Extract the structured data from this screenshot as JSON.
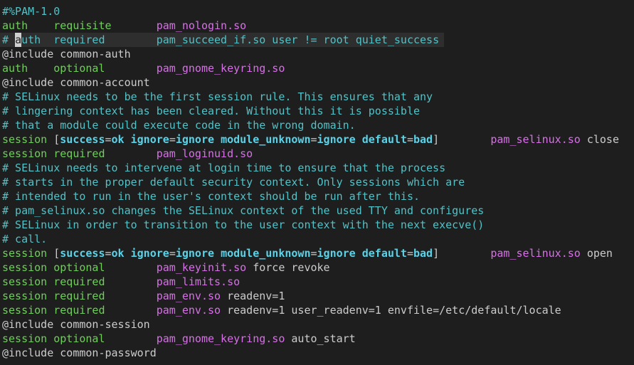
{
  "editor": {
    "colors": {
      "background": "#1e1e1e",
      "current_line": "#2e2e2e",
      "keyword_green": "#6fcf5a",
      "comment_cyan": "#4fc3c8",
      "module_magenta": "#d870e8",
      "bracket_key_cyan": "#5ad3e8",
      "plain": "#cccccc"
    },
    "cursor": {
      "line": 2,
      "col": 2,
      "char": "a"
    },
    "current_line_index": 2,
    "lines": [
      [
        {
          "t": "#%PAM-1.0",
          "c": "comment"
        }
      ],
      [
        {
          "t": "auth    requisite       ",
          "c": "kw"
        },
        {
          "t": "pam_nologin.so",
          "c": "mod"
        }
      ],
      [
        {
          "t": "# auth  required        pam_succeed_if.so user != root quiet_success",
          "c": "comment"
        }
      ],
      [
        {
          "t": "@include common-auth",
          "c": "plain"
        }
      ],
      [
        {
          "t": "auth    optional        ",
          "c": "kw"
        },
        {
          "t": "pam_gnome_keyring.so",
          "c": "mod"
        }
      ],
      [
        {
          "t": "@include common-account",
          "c": "plain"
        }
      ],
      [
        {
          "t": "# SELinux needs to be the first session rule. This ensures that any",
          "c": "comment"
        }
      ],
      [
        {
          "t": "# lingering context has been cleared. Without this it is possible",
          "c": "comment"
        }
      ],
      [
        {
          "t": "# that a module could execute code in the wrong domain.",
          "c": "comment"
        }
      ],
      [
        {
          "t": "session ",
          "c": "kw"
        },
        {
          "t": "[",
          "c": "plain"
        },
        {
          "t": "success",
          "c": "bkey"
        },
        {
          "t": "=",
          "c": "plain"
        },
        {
          "t": "ok",
          "c": "bkey"
        },
        {
          "t": " ",
          "c": "plain"
        },
        {
          "t": "ignore",
          "c": "bkey"
        },
        {
          "t": "=",
          "c": "plain"
        },
        {
          "t": "ignore",
          "c": "bkey"
        },
        {
          "t": " ",
          "c": "plain"
        },
        {
          "t": "module_unknown",
          "c": "bkey"
        },
        {
          "t": "=",
          "c": "plain"
        },
        {
          "t": "ignore",
          "c": "bkey"
        },
        {
          "t": " ",
          "c": "plain"
        },
        {
          "t": "default",
          "c": "bkey"
        },
        {
          "t": "=",
          "c": "plain"
        },
        {
          "t": "bad",
          "c": "bkey"
        },
        {
          "t": "]        ",
          "c": "plain"
        },
        {
          "t": "pam_selinux.so",
          "c": "mod"
        },
        {
          "t": " close",
          "c": "plain"
        }
      ],
      [
        {
          "t": "session required        ",
          "c": "kw"
        },
        {
          "t": "pam_loginuid.so",
          "c": "mod"
        }
      ],
      [
        {
          "t": "# SELinux needs to intervene at login time to ensure that the process",
          "c": "comment"
        }
      ],
      [
        {
          "t": "# starts in the proper default security context. Only sessions which are",
          "c": "comment"
        }
      ],
      [
        {
          "t": "# intended to run in the user's context should be run after this.",
          "c": "comment"
        }
      ],
      [
        {
          "t": "# pam_selinux.so changes the SELinux context of the used TTY and configures",
          "c": "comment"
        }
      ],
      [
        {
          "t": "# SELinux in order to transition to the user context with the next execve()",
          "c": "comment"
        }
      ],
      [
        {
          "t": "# call.",
          "c": "comment"
        }
      ],
      [
        {
          "t": "session ",
          "c": "kw"
        },
        {
          "t": "[",
          "c": "plain"
        },
        {
          "t": "success",
          "c": "bkey"
        },
        {
          "t": "=",
          "c": "plain"
        },
        {
          "t": "ok",
          "c": "bkey"
        },
        {
          "t": " ",
          "c": "plain"
        },
        {
          "t": "ignore",
          "c": "bkey"
        },
        {
          "t": "=",
          "c": "plain"
        },
        {
          "t": "ignore",
          "c": "bkey"
        },
        {
          "t": " ",
          "c": "plain"
        },
        {
          "t": "module_unknown",
          "c": "bkey"
        },
        {
          "t": "=",
          "c": "plain"
        },
        {
          "t": "ignore",
          "c": "bkey"
        },
        {
          "t": " ",
          "c": "plain"
        },
        {
          "t": "default",
          "c": "bkey"
        },
        {
          "t": "=",
          "c": "plain"
        },
        {
          "t": "bad",
          "c": "bkey"
        },
        {
          "t": "]        ",
          "c": "plain"
        },
        {
          "t": "pam_selinux.so",
          "c": "mod"
        },
        {
          "t": " open",
          "c": "plain"
        }
      ],
      [
        {
          "t": "session optional        ",
          "c": "kw"
        },
        {
          "t": "pam_keyinit.so",
          "c": "mod"
        },
        {
          "t": " force revoke",
          "c": "plain"
        }
      ],
      [
        {
          "t": "session required        ",
          "c": "kw"
        },
        {
          "t": "pam_limits.so",
          "c": "mod"
        }
      ],
      [
        {
          "t": "session required        ",
          "c": "kw"
        },
        {
          "t": "pam_env.so",
          "c": "mod"
        },
        {
          "t": " readenv=1",
          "c": "plain"
        }
      ],
      [
        {
          "t": "session required        ",
          "c": "kw"
        },
        {
          "t": "pam_env.so",
          "c": "mod"
        },
        {
          "t": " readenv=1 user_readenv=1 envfile=/etc/default/locale",
          "c": "plain"
        }
      ],
      [
        {
          "t": "@include common-session",
          "c": "plain"
        }
      ],
      [
        {
          "t": "session optional        ",
          "c": "kw"
        },
        {
          "t": "pam_gnome_keyring.so",
          "c": "mod"
        },
        {
          "t": " auto_start",
          "c": "plain"
        }
      ],
      [
        {
          "t": "@include common-password",
          "c": "plain"
        }
      ]
    ]
  }
}
